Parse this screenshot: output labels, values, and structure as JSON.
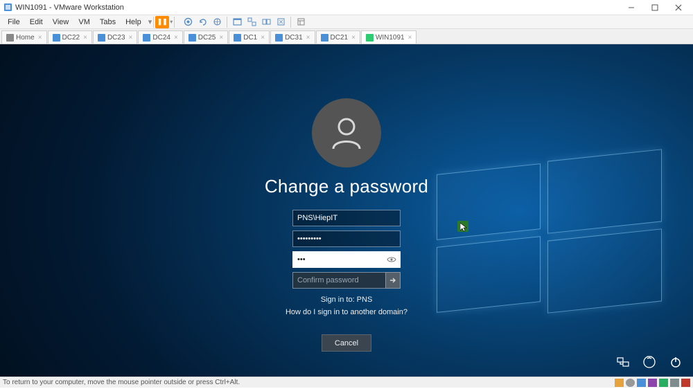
{
  "window": {
    "title": "WIN1091 - VMware Workstation"
  },
  "menu": [
    "File",
    "Edit",
    "View",
    "VM",
    "Tabs",
    "Help"
  ],
  "tabs": {
    "home": "Home",
    "items": [
      "DC22",
      "DC23",
      "DC24",
      "DC25",
      "DC1",
      "DC31",
      "DC21"
    ],
    "active": "WIN1091"
  },
  "login": {
    "heading": "Change a password",
    "username": "PNS\\HiepIT",
    "old_password": "•••••••••",
    "new_password": "•••",
    "confirm_placeholder": "Confirm password",
    "signin_to": "Sign in to: PNS",
    "other_domain": "How do I sign in to another domain?",
    "cancel": "Cancel"
  },
  "statusbar": {
    "hint": "To return to your computer, move the mouse pointer outside or press Ctrl+Alt."
  }
}
